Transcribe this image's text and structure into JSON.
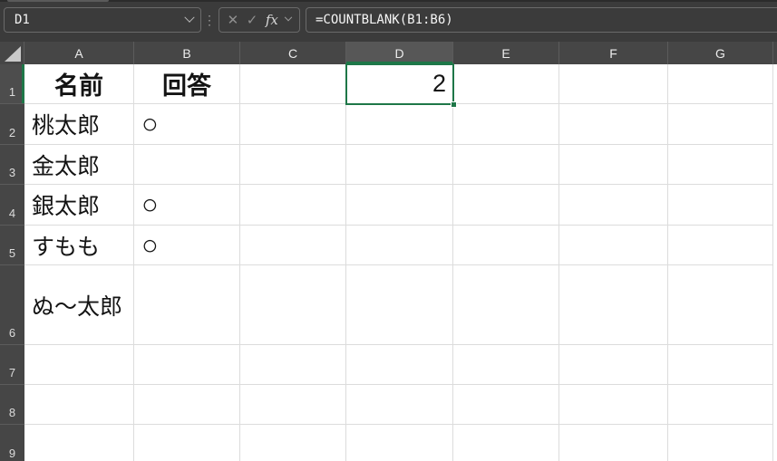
{
  "colors": {
    "selection_green": "#1e7748",
    "topbar_bg": "#3b3b3b",
    "header_bg": "#464646",
    "header_selected_bg": "#575757",
    "gridline": "#dcdcdc"
  },
  "formula_bar": {
    "name_box_value": "D1",
    "formula": "=COUNTBLANK(B1:B6)",
    "icons": {
      "more": "⋮",
      "cancel": "✕",
      "enter": "✓",
      "function": "fx"
    }
  },
  "sheet": {
    "selected_cell": "D1",
    "selected_column": "D",
    "selected_row": "1",
    "column_headers": [
      "A",
      "B",
      "C",
      "D",
      "E",
      "F",
      "G"
    ],
    "row_headers": [
      "1",
      "2",
      "3",
      "4",
      "5",
      "6",
      "7",
      "8",
      "9"
    ],
    "cells": {
      "A1": "名前",
      "B1": "回答",
      "D1": "2",
      "A2": "桃太郎",
      "B2": "○",
      "A3": "金太郎",
      "A4": "銀太郎",
      "B4": "○",
      "A5": "すもも",
      "B5": "○",
      "A6": "ぬ～太郎"
    }
  }
}
